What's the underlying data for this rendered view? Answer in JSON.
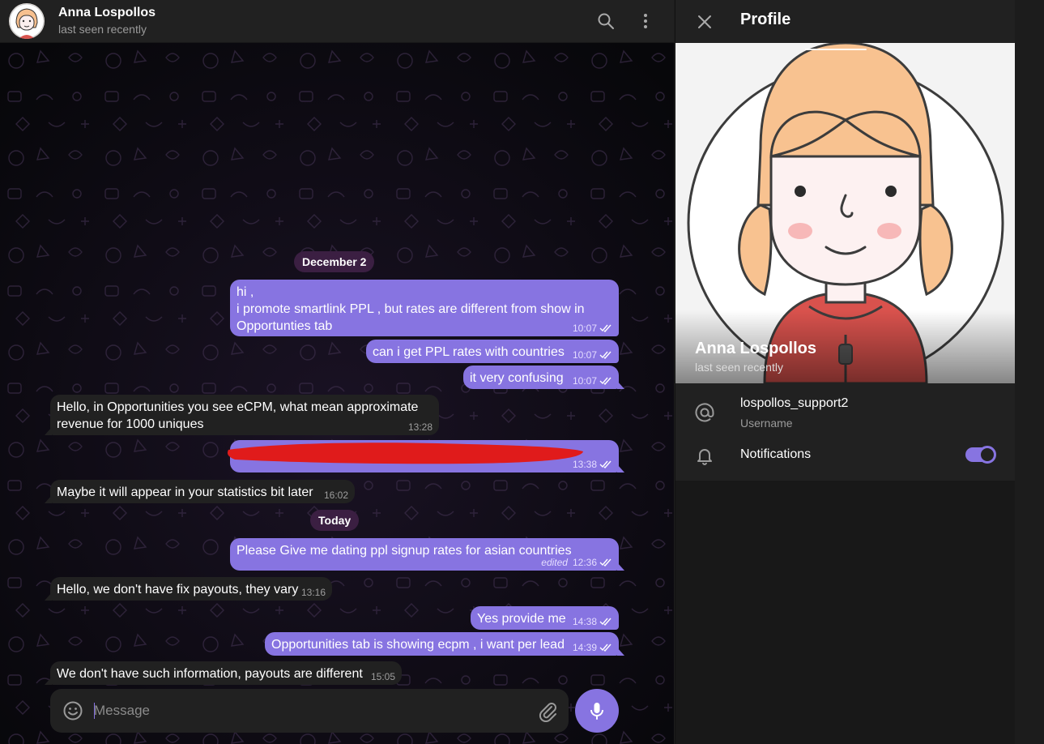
{
  "chat": {
    "peer": {
      "name": "Anna Lospollos",
      "status": "last seen recently"
    },
    "composer": {
      "placeholder": "Message"
    },
    "dates": [
      "December 2",
      "Today"
    ],
    "messages": [
      {
        "dir": "out",
        "lines": [
          "hi ,",
          "i promote smartlink PPL , but rates are different from show in",
          "Opportunties tab"
        ],
        "time": "10:07",
        "read": true
      },
      {
        "dir": "out",
        "lines": [
          "can i get PPL rates with countries"
        ],
        "time": "10:07",
        "read": true
      },
      {
        "dir": "out",
        "lines": [
          "it very confusing"
        ],
        "time": "10:07",
        "read": true
      },
      {
        "dir": "in",
        "lines": [
          "Hello, in Opportunities you see eCPM, what mean approximate",
          "revenue for 1000 uniques"
        ],
        "time": "13:28"
      },
      {
        "dir": "out",
        "lines": [
          ""
        ],
        "time": "13:38",
        "read": true,
        "redacted": true
      },
      {
        "dir": "in",
        "lines": [
          "Maybe it will appear in your statistics bit later"
        ],
        "time": "16:02"
      },
      {
        "dir": "out",
        "lines": [
          "Please Give me dating ppl signup rates for asian countries"
        ],
        "time": "12:36",
        "edited": "edited",
        "read": true
      },
      {
        "dir": "in",
        "lines": [
          "Hello, we don't have fix payouts, they vary"
        ],
        "time": "13:16"
      },
      {
        "dir": "out",
        "lines": [
          "Yes provide me"
        ],
        "time": "14:38",
        "read": true
      },
      {
        "dir": "out",
        "lines": [
          "Opportunities tab is showing ecpm , i want per lead"
        ],
        "time": "14:39",
        "read": true
      },
      {
        "dir": "in",
        "lines": [
          "We don't have such information, payouts are different"
        ],
        "time": "15:05"
      }
    ]
  },
  "profile": {
    "title": "Profile",
    "name": "Anna Lospollos",
    "status": "last seen recently",
    "username": "lospollos_support2",
    "username_label": "Username",
    "notifications_label": "Notifications",
    "notifications_on": true
  },
  "colors": {
    "accent": "#8774e1",
    "incoming": "#212121",
    "date_chip": "#3b1f42"
  },
  "icons": [
    "search-icon",
    "more-vertical-icon",
    "close-icon",
    "at-sign-icon",
    "bell-icon",
    "smile-icon",
    "paperclip-icon",
    "microphone-icon",
    "double-check-icon"
  ]
}
